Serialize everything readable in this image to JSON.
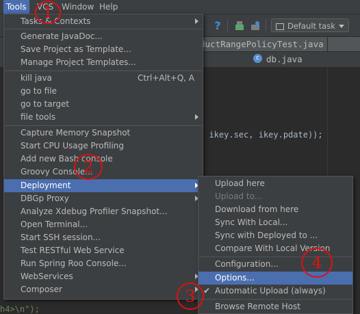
{
  "menubar": {
    "items": [
      {
        "label": "Tools",
        "active": true
      },
      {
        "label": "VCS",
        "active": false
      },
      {
        "label": "Window",
        "active": false
      },
      {
        "label": "Help",
        "active": false
      }
    ]
  },
  "toolbar": {
    "task_combo": "Default task"
  },
  "editor": {
    "tab_top": "ductRangePolicyTest.java",
    "tab_db": "db.java",
    "code_mid": ", ikey.sec, ikey.pdate));",
    "code_bottom": "h4>\\n\");"
  },
  "tools_menu": {
    "items": [
      {
        "label": "Tasks & Contexts"
      },
      {
        "label": "Generate JavaDoc..."
      },
      {
        "label": "Save Project as Template..."
      },
      {
        "label": "Manage Project Templates..."
      },
      {
        "label": "kill java",
        "shortcut": "Ctrl+Alt+Q, A"
      },
      {
        "label": "go to file"
      },
      {
        "label": "go to target"
      },
      {
        "label": "file tools"
      },
      {
        "label": "Capture Memory Snapshot"
      },
      {
        "label": "Start CPU Usage Profiling"
      },
      {
        "label": "Add new Bash console"
      },
      {
        "label": "Groovy Console..."
      },
      {
        "label": "Deployment"
      },
      {
        "label": "DBGp Proxy"
      },
      {
        "label": "Analyze Xdebug Profiler Snapshot..."
      },
      {
        "label": "Open Terminal..."
      },
      {
        "label": "Start SSH session..."
      },
      {
        "label": "Test RESTful Web Service"
      },
      {
        "label": "Run Spring Roo Console..."
      },
      {
        "label": "WebServices"
      },
      {
        "label": "Composer"
      }
    ]
  },
  "deployment_menu": {
    "items": [
      {
        "label": "Upload here"
      },
      {
        "label": "Upload to..."
      },
      {
        "label": "Download from here"
      },
      {
        "label": "Sync With Local..."
      },
      {
        "label": "Sync with Deployed to ..."
      },
      {
        "label": "Compare With Local Version"
      },
      {
        "label": "Configuration..."
      },
      {
        "label": "Options..."
      },
      {
        "label": "Automatic Upload (always)",
        "checked": true
      },
      {
        "label": "Browse Remote Host"
      }
    ]
  },
  "annotations": [
    "1",
    "2",
    "3",
    "4"
  ],
  "colors": {
    "highlight": "#4b6eaf",
    "menu_bg": "#3c3f41",
    "editor_bg": "#2b2b2b",
    "annotation": "#e01010"
  }
}
